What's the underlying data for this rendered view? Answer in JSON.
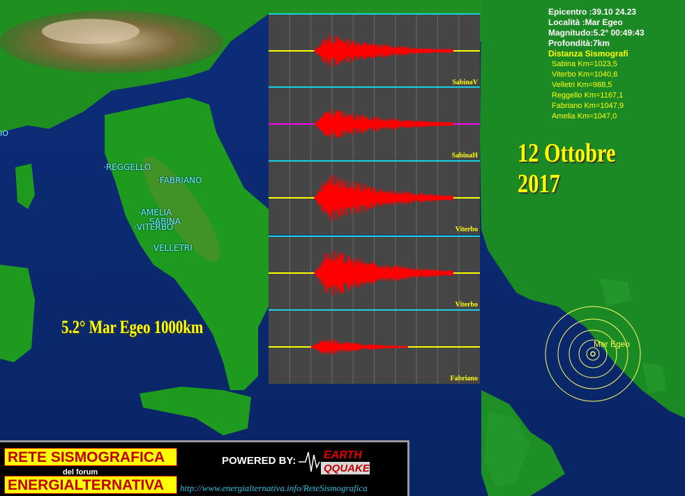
{
  "info": {
    "epicentro": "Epicentro :39.10 24.23",
    "localita": "Località :Mar Egeo",
    "magnitudo": "Magnitudo:5.2° 00:49:43",
    "profondita": "Profondità:7km",
    "distanza_title": "Distanza Sismografi",
    "distances": [
      "Sabina Km=1023,5",
      "Viterbo Km=1040,8",
      "Velletri Km=988,5",
      "Reggello Km=1167,1",
      "Fabriano Km=1047,9",
      "Amelia Km=1047,0"
    ]
  },
  "date": "12 Ottobre 2017",
  "event_caption": "5.2° Mar Egeo 1000km",
  "epicenter_label": "Mar Egeo",
  "cities": [
    "REGGELLO",
    "FABRIANO",
    "AMELIA",
    "SABINA",
    "VITERBO",
    "VELLETRI"
  ],
  "edge_label": "IO",
  "panels": [
    {
      "label": "SabinaV",
      "baseline_color": "#ffff00",
      "signal_color": "#ff0000"
    },
    {
      "label": "SabinaH",
      "baseline_color": "#ff00ff",
      "signal_color": "#ff0000"
    },
    {
      "label": "Viterbo",
      "baseline_color": "#ffff00",
      "signal_color": "#ff0000"
    },
    {
      "label": "Viterbo",
      "baseline_color": "#ffff00",
      "signal_color": "#ff0000"
    },
    {
      "label": "Fabriano",
      "baseline_color": "#ffff00",
      "signal_color": "#ff0000"
    }
  ],
  "banner": {
    "title": "RETE SISMOGRAFICA",
    "subtitle": "del forum",
    "name": "ENERGIALTERNATIVA",
    "powered": "POWERED BY:",
    "logo_top": "EARTH",
    "logo_bottom": "QQUAKE",
    "url": "http://www.energialternativa.info/ReteSismografica"
  }
}
